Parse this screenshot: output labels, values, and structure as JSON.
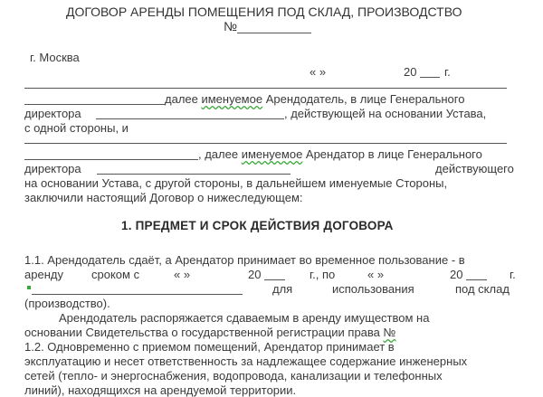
{
  "title": "ДОГОВОР  АРЕНДЫ ПОМЕЩЕНИЯ ПОД СКЛАД, ПРОИЗВОДСТВО",
  "number_prefix": "№",
  "city": "г. Москва",
  "date_quotes": "«   »",
  "date_year_prefix": "20",
  "date_year_suffix": "г.",
  "p1": {
    "l1_a": "далее ",
    "l1_b": "именуемое",
    "l1_c": " Арендодатель, в лице Генерального",
    "l2_a": "директора",
    "l2_b": ", действующей на основании Устава,",
    "l3": "с одной стороны, и"
  },
  "p2": {
    "l1_a": ", далее ",
    "l1_b": "именуемое",
    "l1_c": " Арендатор в лице Генерального",
    "l2_a": "директора",
    "l2_b": "действующего",
    "l3": "на основании Устава, с другой стороны, в дальнейшем именуемые Стороны,",
    "l4": "заключили настоящий Договор о нижеследующем:"
  },
  "section1_heading": "1. ПРЕДМЕТ  И СРОК ДЕЙСТВИЯ ДОГОВОРА",
  "s11": {
    "l1": "1.1. Арендодатель сдаёт, а Арендатор принимает во временное пользование - в",
    "l2_a": "аренду",
    "l2_b": "сроком с",
    "l2_c": "«   »",
    "l2_d": "20",
    "l2_e": "г., по",
    "l2_f": "«   »",
    "l2_g": "20",
    "l2_h": "г.",
    "l3_a": "для",
    "l3_b": "использования",
    "l3_c": "под склад",
    "l4": "(производство)."
  },
  "para2": {
    "l1": "Арендодатель распоряжается сдаваемым в аренду имуществом на",
    "l2_a": "основании Свидетельства о государственной регистрации права ",
    "l2_b": "№"
  },
  "s12": {
    "l1": "1.2.  Одновременно  с  приемом  помещений,  Арендатор  принимает  в",
    "l2": "эксплуатацию и несет ответственность за надлежащее содержание инженерных",
    "l3": "сетей (тепло- и энергоснабжения, водопровода, канализации и телефонных",
    "l4": "линий), находящихся на арендуемой территории."
  },
  "colors": {
    "text": "#3a3a3a",
    "rule": "#555555",
    "spellcheck": "#3aa83a"
  }
}
